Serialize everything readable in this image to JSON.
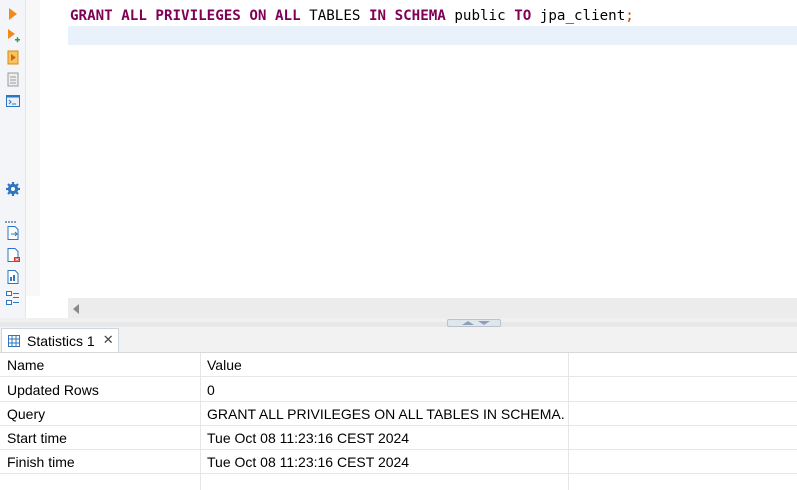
{
  "toolbar": {
    "buttons": [
      {
        "icon": "execute-statement-icon"
      },
      {
        "icon": "execute-in-new-tab-icon"
      },
      {
        "icon": "execute-script-icon"
      },
      {
        "icon": "execute-script-new-tab-icon"
      },
      {
        "icon": "explain-plan-icon"
      },
      {
        "icon": "settings-gear-icon"
      },
      {
        "icon": "export-icon"
      },
      {
        "icon": "load-script-icon"
      },
      {
        "icon": "save-script-icon"
      },
      {
        "icon": "outline-icon"
      }
    ],
    "colors": {
      "run": "#f08a1b",
      "blue": "#2f76c1",
      "red": "#d9322b"
    }
  },
  "editor": {
    "sql": {
      "t1": "GRANT ALL PRIVILEGES ON ALL",
      "t2": " TABLES ",
      "t3": "IN SCHEMA",
      "t4": " public ",
      "t5": "TO",
      "t6": " jpa_client",
      "t7": ";"
    },
    "keyword_color": "#7f0055"
  },
  "results": {
    "tab_label": "Statistics 1",
    "columns": [
      "Name",
      "Value"
    ],
    "rows": [
      {
        "name": "Updated Rows",
        "value": "0"
      },
      {
        "name": "Query",
        "value": "GRANT ALL PRIVILEGES ON ALL TABLES IN SCHEMA..."
      },
      {
        "name": "Start time",
        "value": "Tue Oct 08 11:23:16 CEST 2024"
      },
      {
        "name": "Finish time",
        "value": "Tue Oct 08 11:23:16 CEST 2024"
      }
    ]
  }
}
